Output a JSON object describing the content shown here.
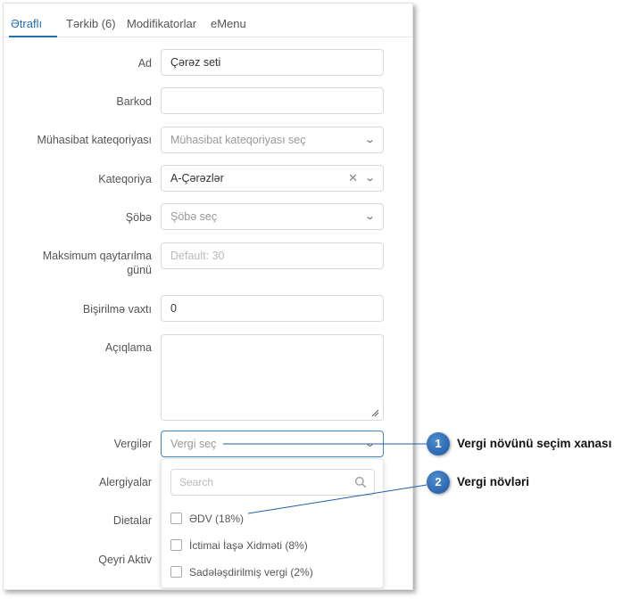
{
  "tabs": [
    {
      "label": "Ətraflı",
      "active": true
    },
    {
      "label": "Tərkib (6)",
      "active": false
    },
    {
      "label": "Modifikatorlar",
      "active": false
    },
    {
      "label": "eMenu",
      "active": false
    }
  ],
  "form": {
    "name": {
      "label": "Ad",
      "value": "Çərəz seti"
    },
    "barcode": {
      "label": "Barkod",
      "value": ""
    },
    "accounting_category": {
      "label": "Mühasibat kateqoriyası",
      "placeholder": "Mühasibat kateqoriyası seç"
    },
    "category": {
      "label": "Kateqoriya",
      "value": "A-Çərəzlər"
    },
    "department": {
      "label": "Şöbə",
      "placeholder": "Şöbə seç"
    },
    "max_return": {
      "label_line1": "Maksimum qaytarılma",
      "label_line2": "günü",
      "placeholder": "Default: 30"
    },
    "cooking_time": {
      "label": "Bişirilmə vaxtı",
      "value": "0"
    },
    "description": {
      "label": "Açıqlama",
      "value": ""
    },
    "taxes": {
      "label": "Vergilər",
      "placeholder": "Vergi seç"
    },
    "allergens": {
      "label": "Alergiyalar"
    },
    "diets": {
      "label": "Dietalar"
    },
    "inactive": {
      "label": "Qeyri Aktiv"
    }
  },
  "tax_dropdown": {
    "search_placeholder": "Search",
    "options": [
      "ƏDV (18%)",
      "İctimai İaşə Xidməti (8%)",
      "Sadələşdirilmiş vergi (2%)"
    ]
  },
  "callouts": [
    {
      "number": "1",
      "text": "Vergi növünü seçim xanası"
    },
    {
      "number": "2",
      "text": "Vergi növləri"
    }
  ],
  "colors": {
    "accent": "#1f6fb7",
    "badge": "#2a6ab8",
    "focus_border": "#3a86d4"
  },
  "icons": [
    "chevron-down-icon",
    "clear-icon",
    "search-icon",
    "resize-handle-icon",
    "checkbox"
  ]
}
